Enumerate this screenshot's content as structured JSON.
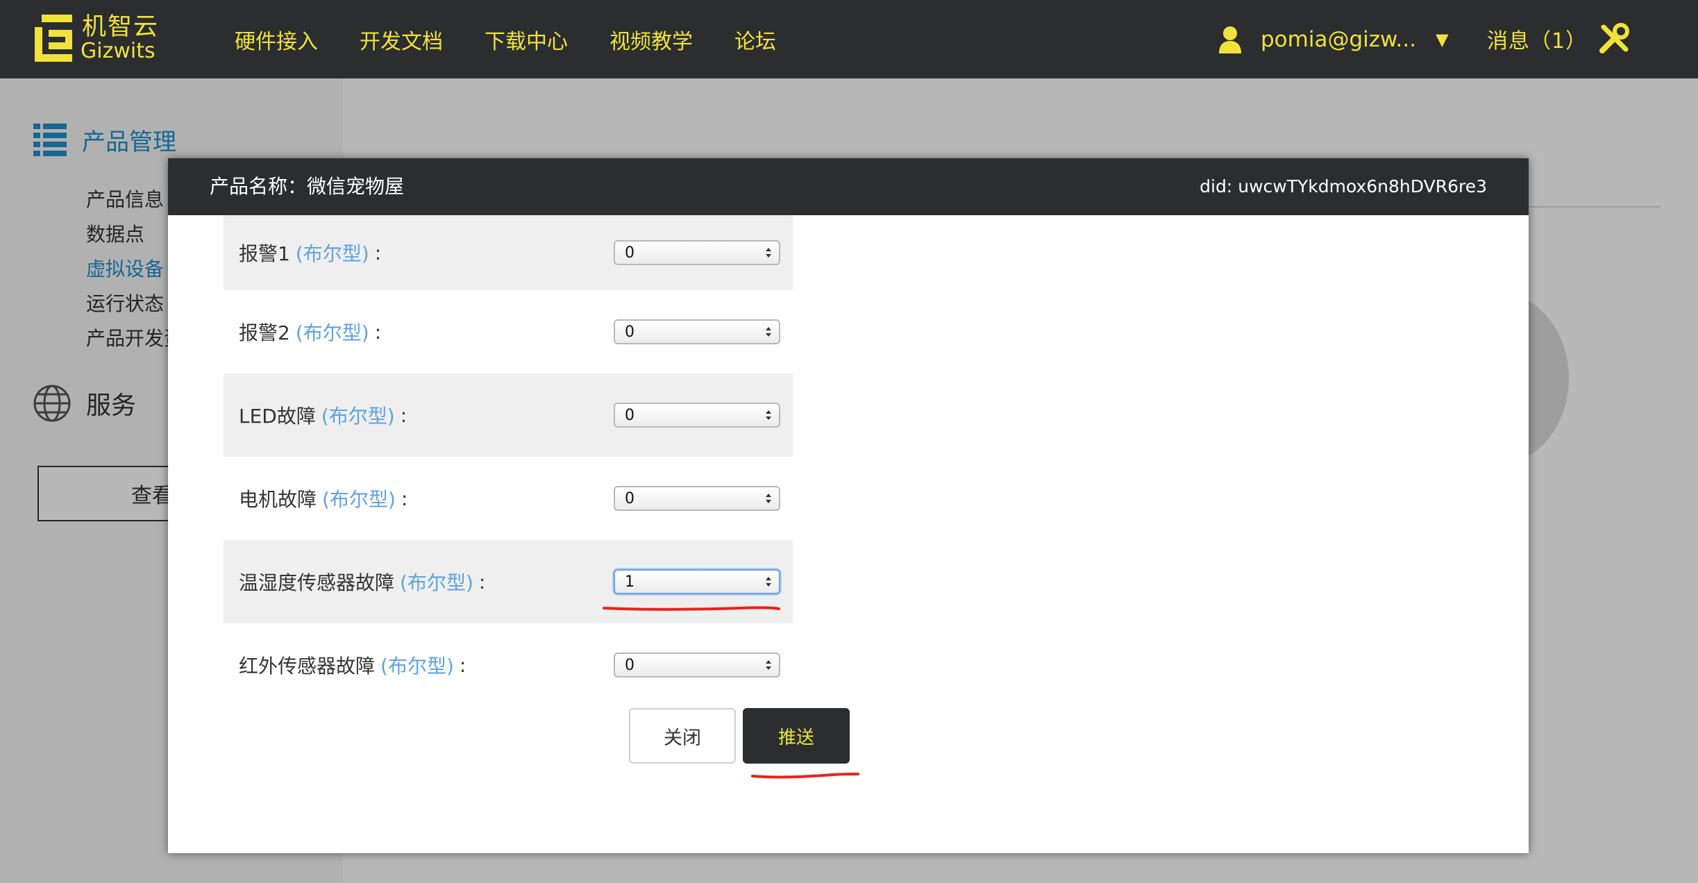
{
  "brand": {
    "name_cn": "机智云",
    "name_en": "Gizwits",
    "color": "#f0e23b"
  },
  "nav": {
    "links": [
      {
        "label": "硬件接入"
      },
      {
        "label": "开发文档"
      },
      {
        "label": "下载中心"
      },
      {
        "label": "视频教学"
      },
      {
        "label": "论坛"
      }
    ],
    "user": {
      "name": "pomia@gizw...",
      "icon": "user-icon",
      "dropdown_icon": "caret-down-icon"
    },
    "messages": "消息（1）",
    "tools_icon": "tools-icon"
  },
  "sidebar": {
    "section1": {
      "label": "产品管理",
      "icon": "server-stack-icon"
    },
    "items": [
      {
        "label": "产品信息",
        "active": false
      },
      {
        "label": "数据点",
        "active": false
      },
      {
        "label": "虚拟设备",
        "active": true
      },
      {
        "label": "运行状态",
        "active": false
      },
      {
        "label": "产品开发资",
        "active": false
      }
    ],
    "section2": {
      "label": "服务",
      "icon": "globe-icon"
    },
    "button": "查看统"
  },
  "modal": {
    "title": "产品名称：微信宠物屋",
    "did_label": "did:",
    "did_value": "uwcwTYkdmox6n8hDVR6re3",
    "fields": [
      {
        "label": "报警1",
        "type": "(布尔型)",
        "colon": ":",
        "value": "0",
        "shaded": true,
        "focused": false
      },
      {
        "label": "报警2",
        "type": "(布尔型)",
        "colon": ":",
        "value": "0",
        "shaded": false,
        "focused": false
      },
      {
        "label": "LED故障",
        "type": "(布尔型)",
        "colon": ":",
        "value": "0",
        "shaded": true,
        "focused": false
      },
      {
        "label": "电机故障",
        "type": "(布尔型)",
        "colon": ":",
        "value": "0",
        "shaded": false,
        "focused": false
      },
      {
        "label": "温湿度传感器故障",
        "type": "(布尔型)",
        "colon": ":",
        "value": "1",
        "shaded": true,
        "focused": true
      },
      {
        "label": "红外传感器故障",
        "type": "(布尔型)",
        "colon": ":",
        "value": "0",
        "shaded": false,
        "focused": false
      }
    ],
    "close_label": "关闭",
    "push_label": "推送",
    "annotation_color": "#e8231b"
  }
}
